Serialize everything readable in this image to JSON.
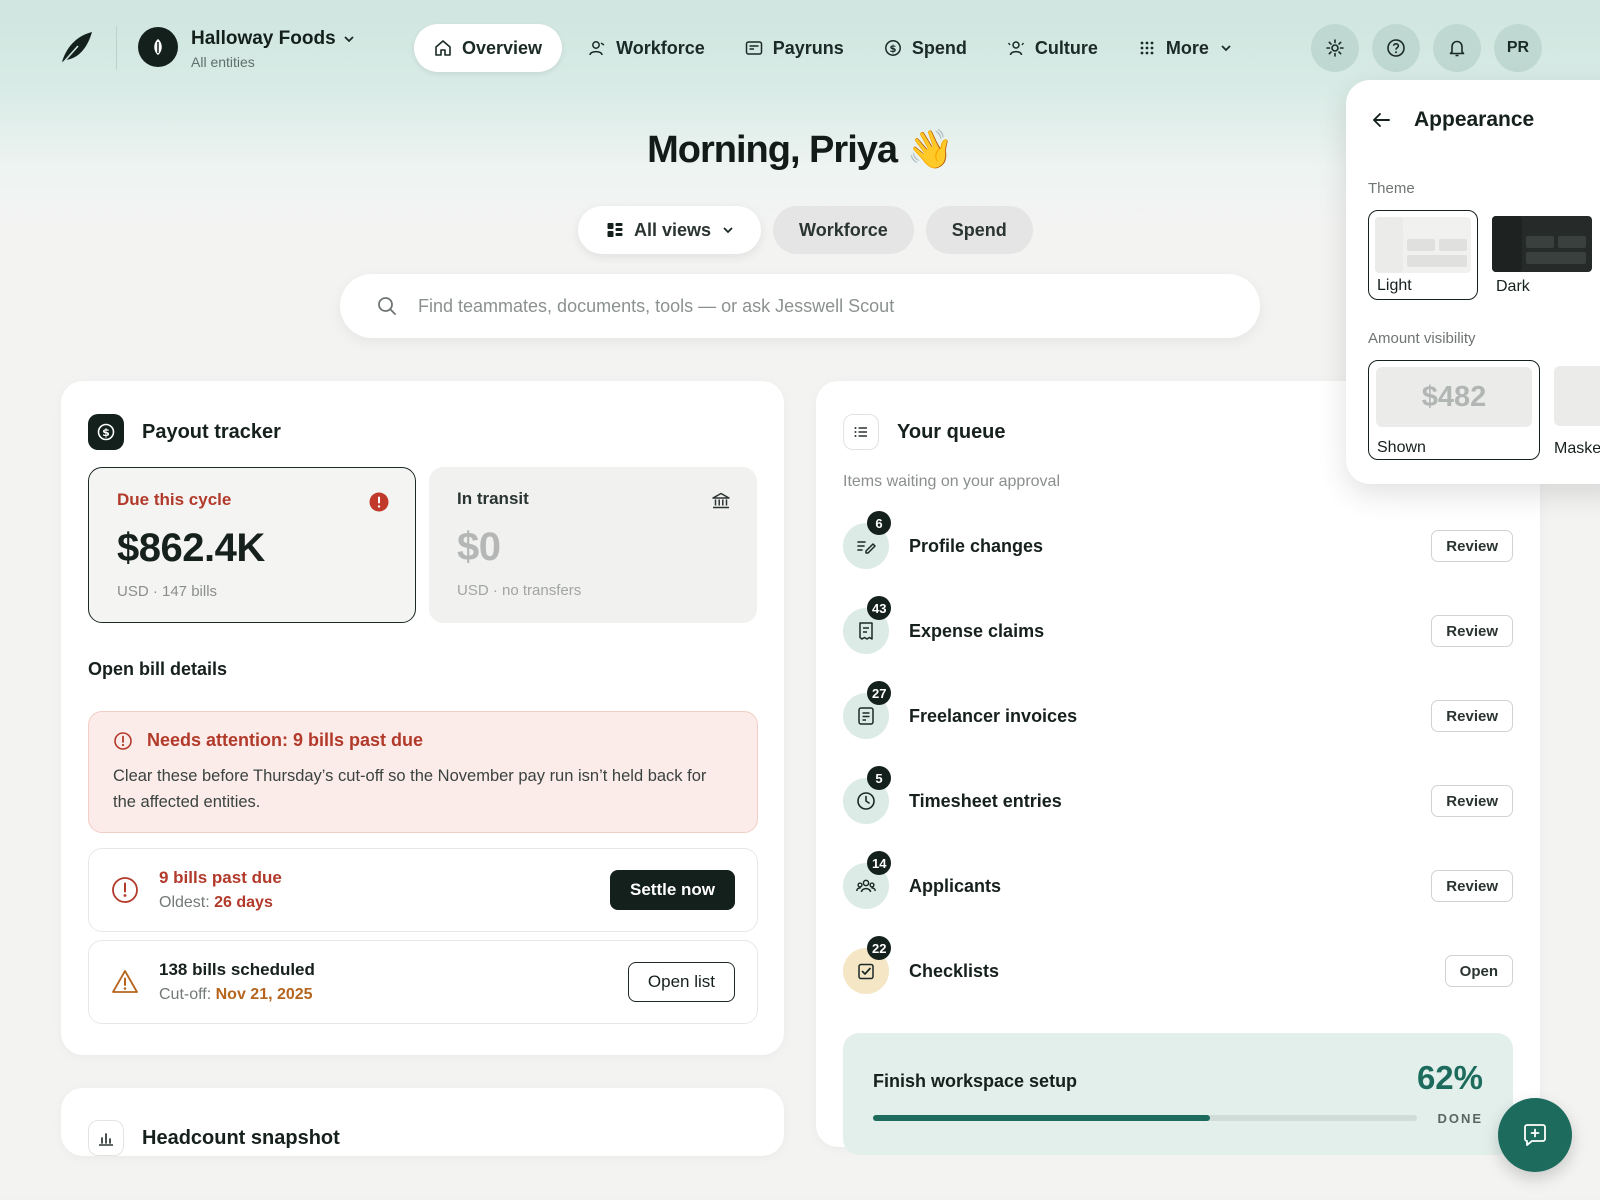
{
  "org": {
    "name": "Halloway Foods",
    "sub": "All entities"
  },
  "nav": [
    {
      "label": "Overview",
      "icon": "home-icon",
      "active": true
    },
    {
      "label": "Workforce",
      "icon": "person-icon"
    },
    {
      "label": "Payruns",
      "icon": "payslip-icon"
    },
    {
      "label": "Spend",
      "icon": "dollar-coin-icon"
    },
    {
      "label": "Culture",
      "icon": "people-icon"
    },
    {
      "label": "More",
      "icon": "grid-dots-icon"
    }
  ],
  "top_actions": {
    "avatar_initials": "PR"
  },
  "greeting": {
    "text": "Morning, Priya",
    "emoji": "👋"
  },
  "views": {
    "primary": "All views",
    "pills": [
      "Workforce",
      "Spend"
    ]
  },
  "search": {
    "placeholder": "Find teammates, documents, tools — or ask Jesswell Scout"
  },
  "payout": {
    "title": "Payout tracker",
    "due": {
      "label": "Due this cycle",
      "amount": "$862.4K",
      "sub": "USD · 147 bills"
    },
    "transit": {
      "label": "In transit",
      "amount": "$0",
      "sub": "USD · no transfers"
    },
    "section_label": "Open bill details",
    "alert": {
      "title": "Needs attention: 9 bills past due",
      "body": "Clear these before Thursday’s cut-off so the November pay run isn’t held back for the affected entities."
    },
    "past_due": {
      "title": "9 bills past due",
      "meta_label": "Oldest:",
      "meta_value": "26 days",
      "button": "Settle now"
    },
    "scheduled": {
      "title": "138 bills scheduled",
      "meta_label": "Cut-off:",
      "meta_value": "Nov 21, 2025",
      "button": "Open list"
    }
  },
  "headcount": {
    "title": "Headcount snapshot"
  },
  "queue": {
    "title": "Your queue",
    "subtitle": "Items waiting on your approval",
    "items": [
      {
        "label": "Profile changes",
        "count": "6",
        "action": "Review",
        "icon": "edit-lines-icon"
      },
      {
        "label": "Expense claims",
        "count": "43",
        "action": "Review",
        "icon": "receipt-icon"
      },
      {
        "label": "Freelancer invoices",
        "count": "27",
        "action": "Review",
        "icon": "invoice-icon"
      },
      {
        "label": "Timesheet entries",
        "count": "5",
        "action": "Review",
        "icon": "clock-icon"
      },
      {
        "label": "Applicants",
        "count": "14",
        "action": "Review",
        "icon": "applicants-icon"
      },
      {
        "label": "Checklists",
        "count": "22",
        "action": "Open",
        "icon": "checklist-icon"
      }
    ],
    "setup": {
      "title": "Finish workspace setup",
      "percent": "62%",
      "progress": 0.62,
      "done_label": "DONE"
    }
  },
  "appearance": {
    "title": "Appearance",
    "theme_label": "Theme",
    "themes": [
      "Light",
      "Dark"
    ],
    "visibility_label": "Amount visibility",
    "visibility": {
      "preview": "$482",
      "shown": "Shown",
      "masked": "Masked"
    }
  },
  "colors": {
    "accent": "#1c6b5d",
    "danger": "#b23a2b",
    "warning": "#b5651d",
    "ink": "#13201c"
  }
}
